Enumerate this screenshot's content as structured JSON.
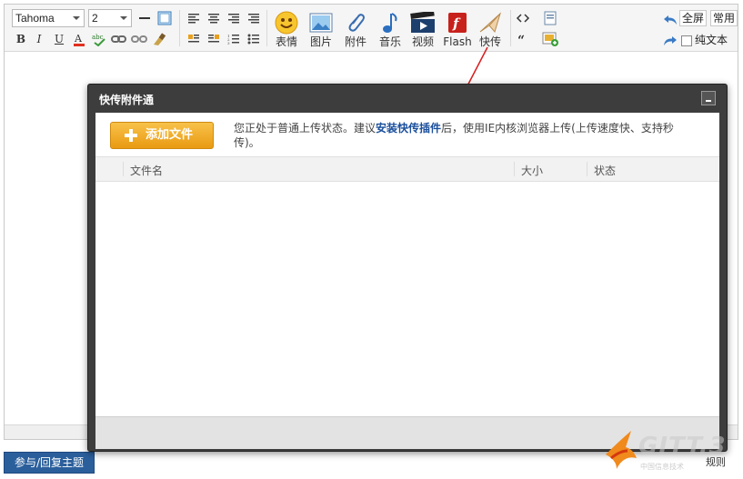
{
  "toolbar": {
    "font_family": "Tahoma",
    "font_size": "2",
    "big_buttons": {
      "emoji": "表情",
      "image": "图片",
      "attachment": "附件",
      "music": "音乐",
      "video": "视频",
      "flash": "Flash",
      "quick_upload": "快传"
    },
    "fullscreen": "全屏",
    "common": "常用",
    "plain_text": "纯文本"
  },
  "dialog": {
    "title": "快传附件通",
    "add_file": "添加文件",
    "notice_before": "您正处于普通上传状态。建议",
    "notice_link": "安装快传插件",
    "notice_after": "后，使用IE内核浏览器上传(上传速度快、支持秒传)。",
    "columns": [
      "文件名",
      "大小",
      "状态"
    ],
    "files": []
  },
  "reply_button": "参与/回复主题",
  "watermark": {
    "brand": "GITT.3",
    "sub": "中国信息技术",
    "rules": "规则"
  },
  "colors": {
    "accent_orange": "#f2ad2b",
    "dialog_frame": "#3d3d3d",
    "reply_button": "#2b5f9c",
    "link": "#1a4f9c",
    "annotation_arrow": "#d91c1c"
  }
}
